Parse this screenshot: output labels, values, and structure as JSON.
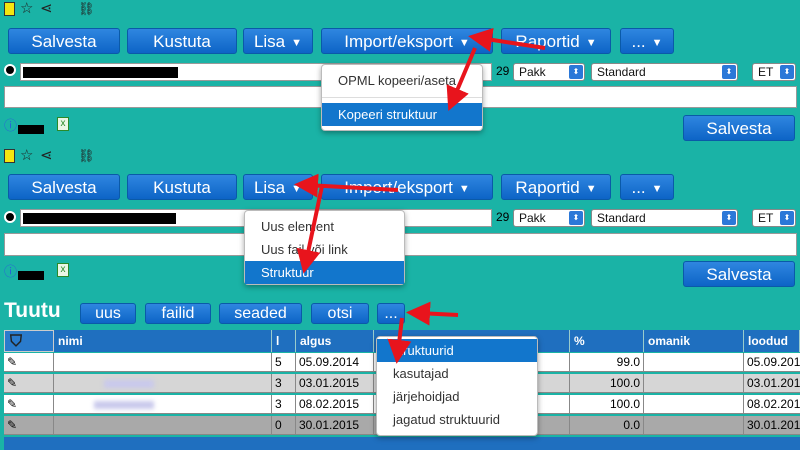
{
  "toolbar_buttons": {
    "save": "Salvesta",
    "delete": "Kustuta",
    "add": "Lisa",
    "import_export": "Import/eksport",
    "reports": "Raportid",
    "more": "..."
  },
  "caret": "▼",
  "form": {
    "number": "29",
    "select_type": "Pakk",
    "select_template": "Standard",
    "select_lang": "ET",
    "save": "Salvesta"
  },
  "import_menu": {
    "items": [
      "OPML kopeeri/aseta",
      "Kopeeri struktuur"
    ],
    "selected_index": 1
  },
  "add_menu": {
    "items": [
      "Uus element",
      "Uus fail või link",
      "Struktuur"
    ],
    "selected_index": 2
  },
  "list_toolbar": {
    "title": "Tuutu",
    "buttons": [
      "uus",
      "failid",
      "seaded",
      "otsi",
      "..."
    ]
  },
  "more_menu": {
    "items": [
      "struktuurid",
      "kasutajad",
      "järjehoidjad",
      "jagatud struktuurid"
    ],
    "selected_index": 0
  },
  "table": {
    "columns": [
      "nimi",
      "l",
      "algus",
      "%",
      "omanik",
      "loodud"
    ],
    "rows": [
      {
        "l": "5",
        "algus": "05.09.2014",
        "pct": "99.0",
        "loodud": "05.09.201"
      },
      {
        "l": "3",
        "algus": "03.01.2015",
        "pct": "100.0",
        "loodud": "03.01.201"
      },
      {
        "l": "3",
        "algus": "08.02.2015",
        "pct": "100.0",
        "loodud": "08.02.201"
      },
      {
        "l": "0",
        "algus": "30.01.2015",
        "pct": "0.0",
        "loodud": "30.01.201"
      }
    ]
  },
  "colors": {
    "accent": "#1276cc",
    "background": "#1ab3a6",
    "arrow": "#e8141c"
  }
}
